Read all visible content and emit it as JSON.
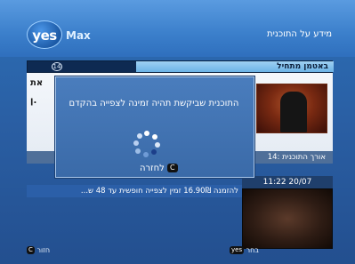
{
  "brand": {
    "logo": "yes",
    "channel": "Max",
    "screen_title": "מידע על התוכנית"
  },
  "program": {
    "title": "באטמן מתחיל",
    "rating_badge": "14",
    "synopsis_fragments": [
      "את",
      "ן."
    ],
    "length_label": "אורך התוכנית",
    "length_value": ":14"
  },
  "promo": "להזמנה  16.90₪  זמין לצפייה חופשית עד 48 ש...",
  "clock": "11:22  20/07",
  "modal": {
    "message": "התוכנית שביקשת תהיה זמינה לצפייה בהקדם",
    "back_label": "לחזרה",
    "back_key": "C"
  },
  "bottom": {
    "back_label": "חזור",
    "back_key": "C",
    "choose_label": "בחר",
    "choose_key": "yes"
  },
  "colors": {
    "background": "#2a5fa4",
    "header_light": "#9fd0f3",
    "modal": "#3f72b2"
  }
}
